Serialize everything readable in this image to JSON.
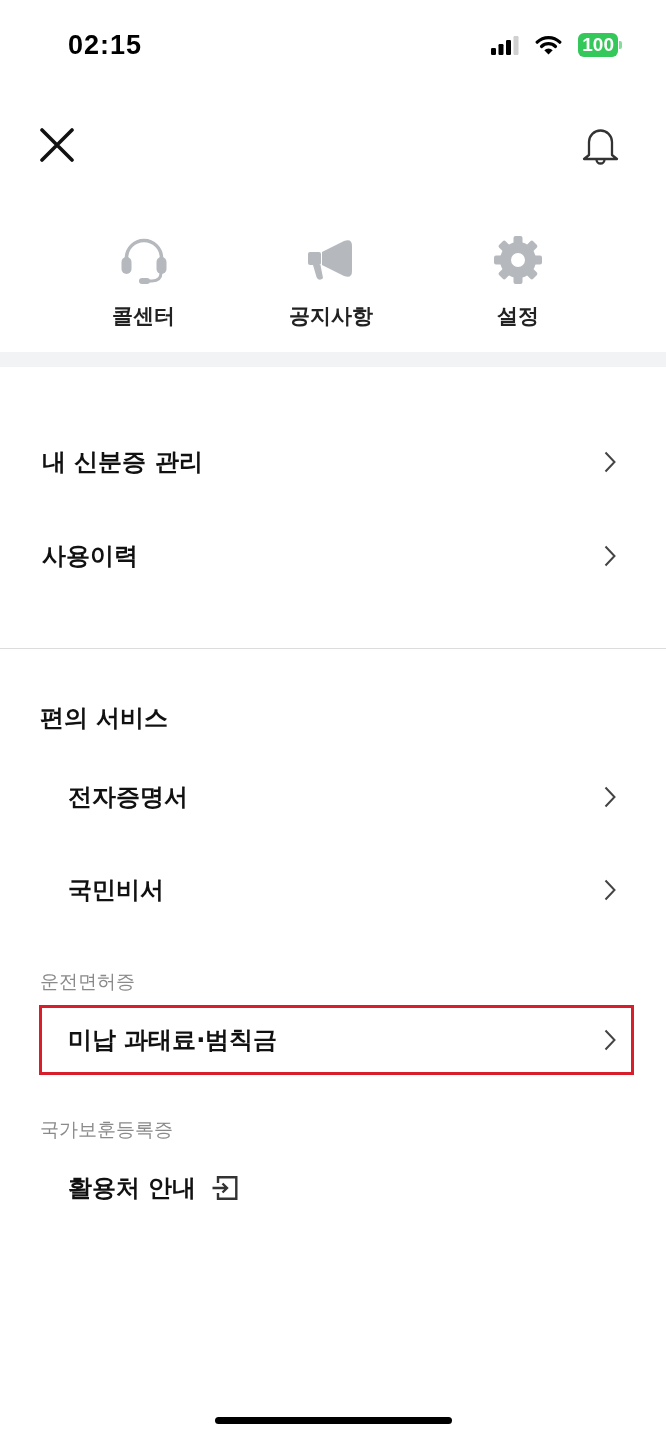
{
  "status_bar": {
    "time": "02:15",
    "battery": "100"
  },
  "shortcuts": [
    {
      "label": "콜센터",
      "kind": "headset"
    },
    {
      "label": "공지사항",
      "kind": "megaphone"
    },
    {
      "label": "설정",
      "kind": "gear"
    }
  ],
  "menu": [
    {
      "label": "내 신분증 관리",
      "kind": "chevron",
      "highlighted": false
    },
    {
      "label": "사용이력",
      "kind": "chevron",
      "highlighted": false
    }
  ],
  "convenience": {
    "title": "편의 서비스",
    "items": [
      {
        "label": "전자증명서",
        "kind": "chevron",
        "highlighted": false
      },
      {
        "label": "국민비서",
        "kind": "chevron",
        "highlighted": false
      }
    ]
  },
  "categories": [
    {
      "title": "운전면허증",
      "items": [
        {
          "label": "미납 과태료·범칙금",
          "kind": "chevron",
          "highlighted": true
        }
      ]
    },
    {
      "title": "국가보훈등록증",
      "items": [
        {
          "label": "활용처 안내",
          "kind": "external",
          "highlighted": false
        }
      ]
    }
  ]
}
